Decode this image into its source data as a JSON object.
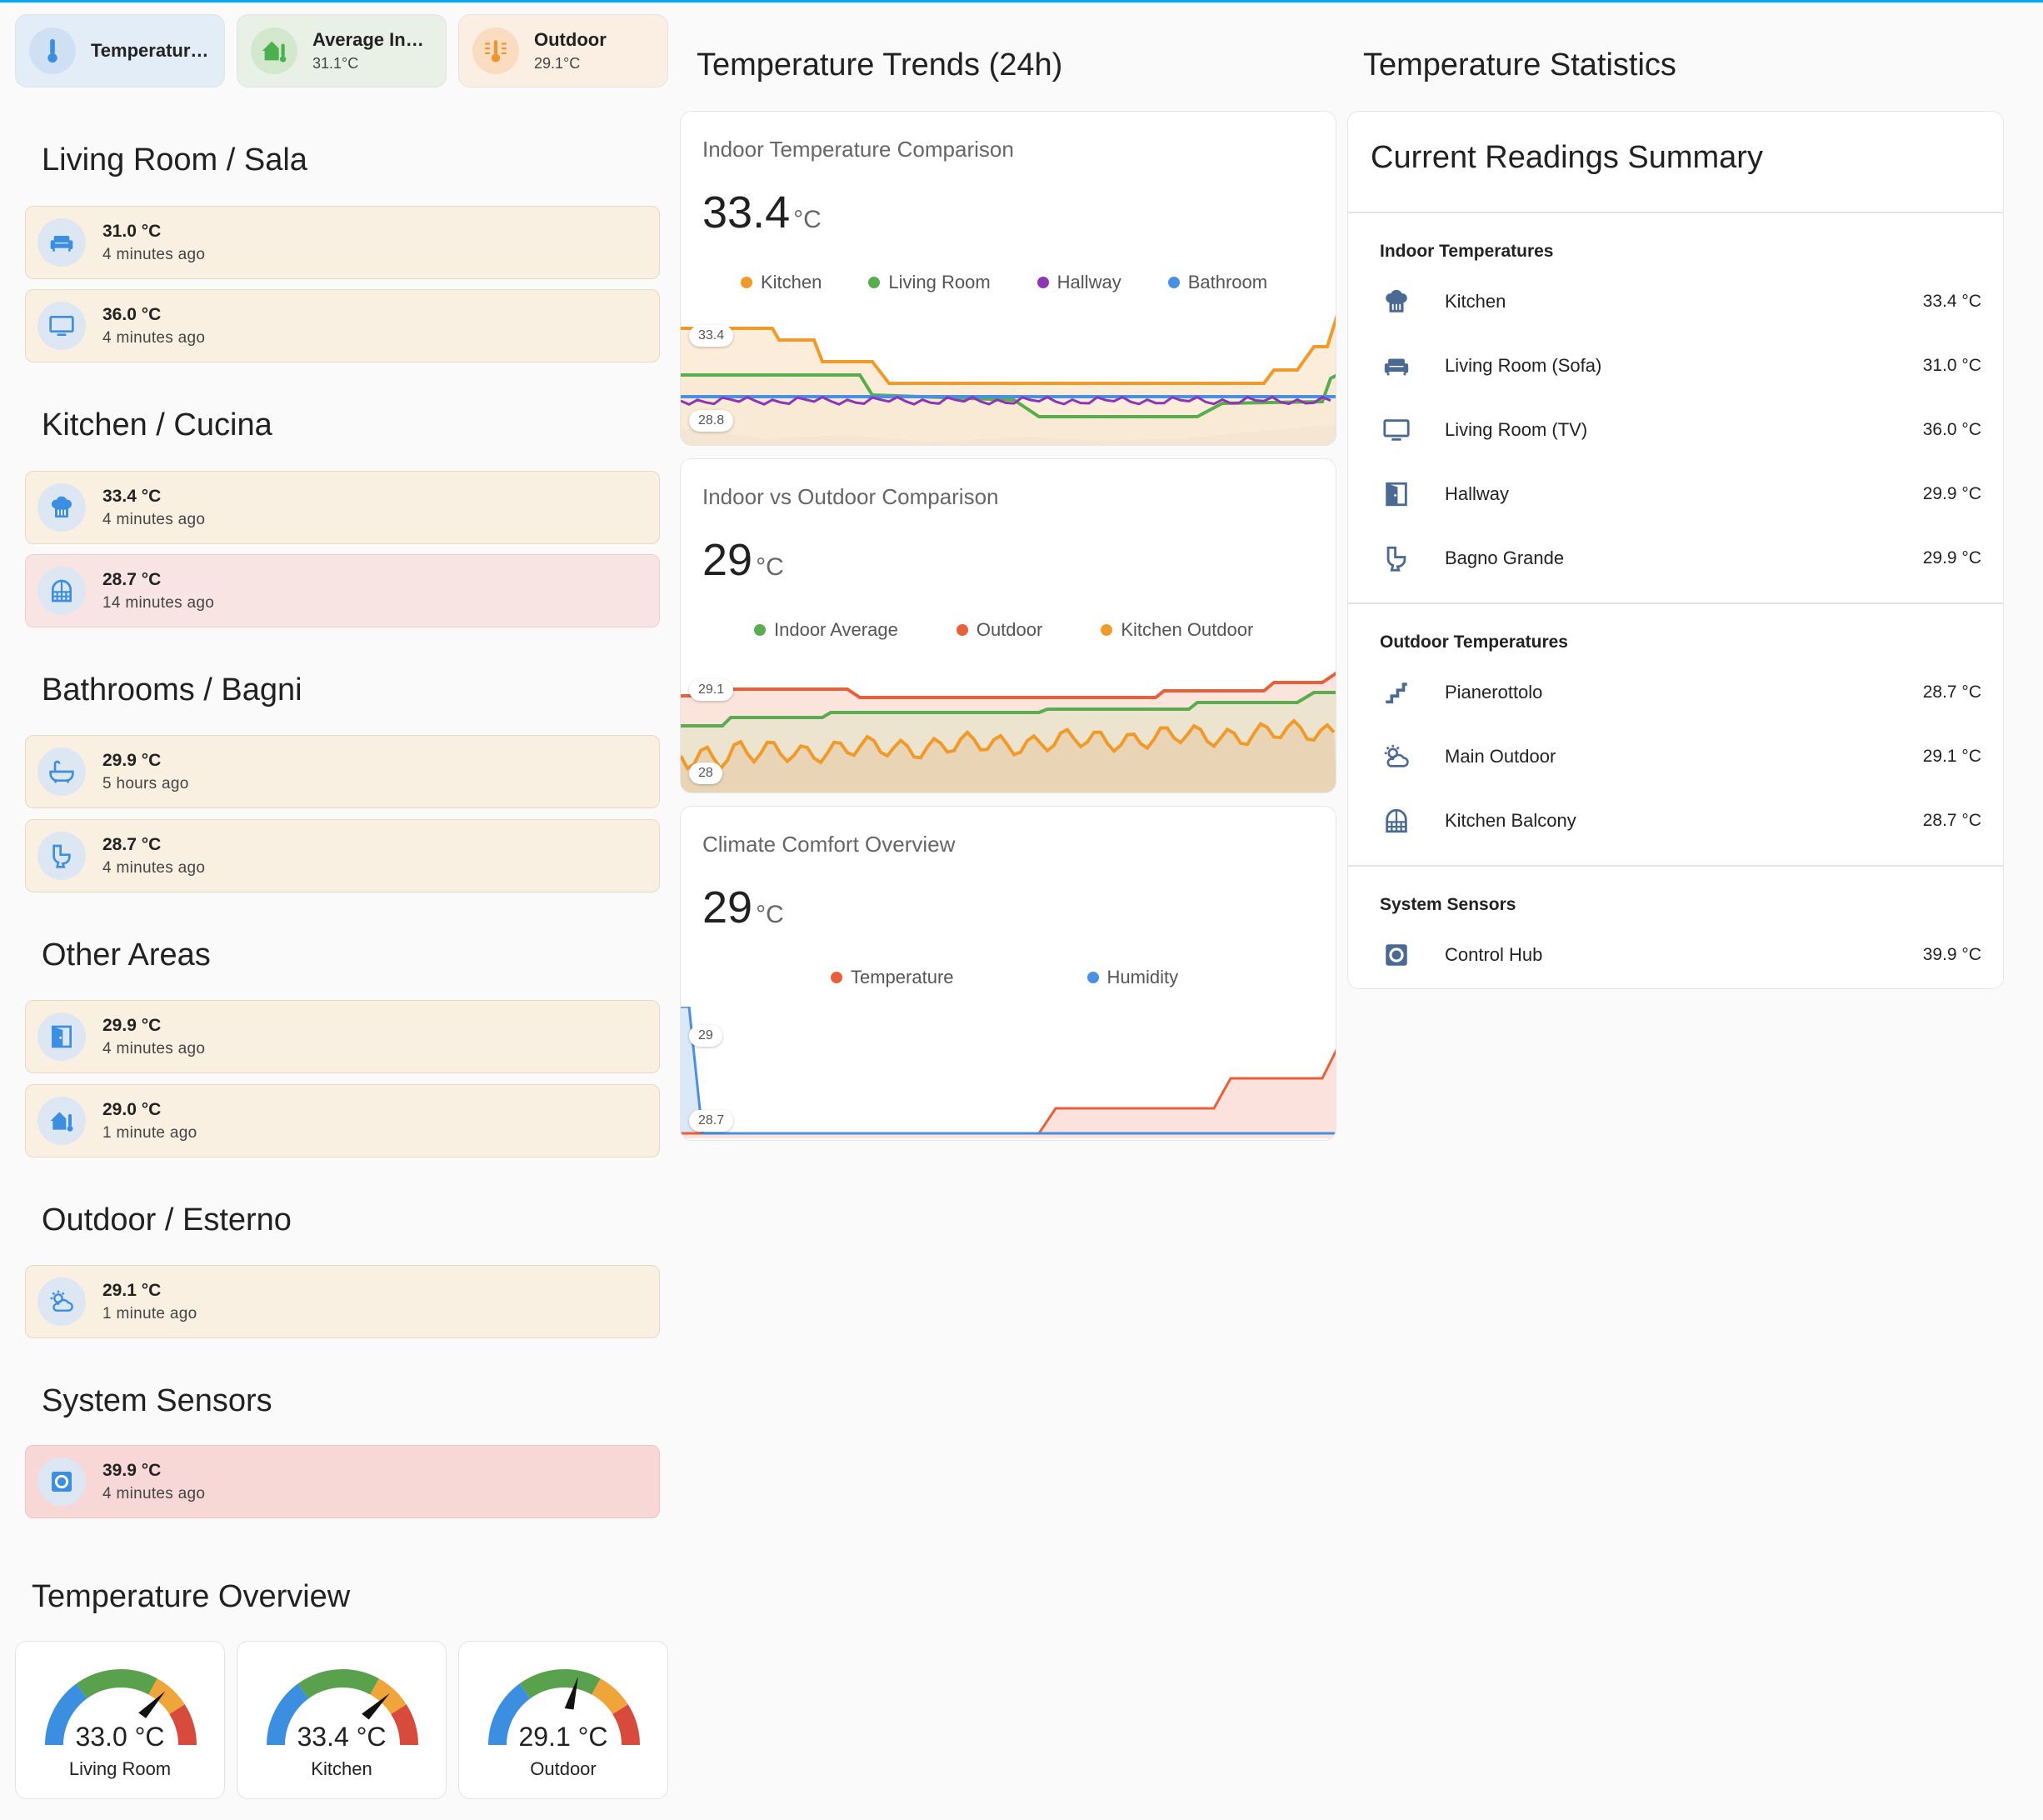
{
  "chips": [
    {
      "label": "Temperature...",
      "value": "",
      "icon": "thermometer-icon",
      "bg": "#e3edf8",
      "icon_bg": "#cfe0f4",
      "icon_color": "#3b8ee0"
    },
    {
      "label": "Average Indo...",
      "value": "31.1°C",
      "icon": "home-thermometer-icon",
      "bg": "#e9f1e6",
      "icon_bg": "#d3e7cd",
      "icon_color": "#4caf50"
    },
    {
      "label": "Outdoor",
      "value": "29.1°C",
      "icon": "sun-thermometer-icon",
      "bg": "#fbeee2",
      "icon_bg": "#fadcc0",
      "icon_color": "#f0942e"
    }
  ],
  "sections": [
    {
      "title": "Living Room / Sala",
      "tiles": [
        {
          "value": "31.0 °C",
          "ago": "4 minutes ago",
          "icon": "sofa-icon",
          "tone": "warm"
        },
        {
          "value": "36.0 °C",
          "ago": "4 minutes ago",
          "icon": "tv-icon",
          "tone": "warm"
        }
      ]
    },
    {
      "title": "Kitchen / Cucina",
      "tiles": [
        {
          "value": "33.4 °C",
          "ago": "4 minutes ago",
          "icon": "chef-hat-icon",
          "tone": "warm"
        },
        {
          "value": "28.7 °C",
          "ago": "14 minutes ago",
          "icon": "window-icon",
          "tone": "hot"
        }
      ]
    },
    {
      "title": "Bathrooms / Bagni",
      "tiles": [
        {
          "value": "29.9 °C",
          "ago": "5 hours ago",
          "icon": "bathtub-icon",
          "tone": "warm"
        },
        {
          "value": "28.7 °C",
          "ago": "4 minutes ago",
          "icon": "toilet-icon",
          "tone": "warm"
        }
      ]
    },
    {
      "title": "Other Areas",
      "tiles": [
        {
          "value": "29.9 °C",
          "ago": "4 minutes ago",
          "icon": "door-icon",
          "tone": "warm"
        },
        {
          "value": "29.0 °C",
          "ago": "1 minute ago",
          "icon": "home-thermometer-icon",
          "tone": "warm"
        }
      ]
    },
    {
      "title": "Outdoor / Esterno",
      "tiles": [
        {
          "value": "29.1 °C",
          "ago": "1 minute ago",
          "icon": "weather-partly-cloudy-icon",
          "tone": "warm"
        }
      ]
    },
    {
      "title": "System Sensors",
      "tiles": [
        {
          "value": "39.9 °C",
          "ago": "4 minutes ago",
          "icon": "hub-icon",
          "tone": "hotter"
        }
      ]
    }
  ],
  "overview": {
    "title": "Temperature Overview",
    "gauges": [
      {
        "value": "33.0 °C",
        "label": "Living Room",
        "num": 33.0
      },
      {
        "value": "33.4 °C",
        "label": "Kitchen",
        "num": 33.4
      },
      {
        "value": "29.1 °C",
        "label": "Outdoor",
        "num": 29.1
      }
    ]
  },
  "trends": {
    "title": "Temperature Trends (24h)",
    "cards": [
      {
        "title": "Indoor Temperature Comparison",
        "big": "33.4",
        "unit": "°C",
        "legend": [
          {
            "name": "Kitchen",
            "color": "#f09a2a"
          },
          {
            "name": "Living Room",
            "color": "#5aad4f"
          },
          {
            "name": "Hallway",
            "color": "#8e35b5"
          },
          {
            "name": "Bathroom",
            "color": "#4a90e2"
          }
        ],
        "badge_top": "33.4",
        "badge_bottom": "28.8"
      },
      {
        "title": "Indoor vs Outdoor Comparison",
        "big": "29",
        "unit": "°C",
        "legend": [
          {
            "name": "Indoor Average",
            "color": "#5aad4f"
          },
          {
            "name": "Outdoor",
            "color": "#e8603a"
          },
          {
            "name": "Kitchen Outdoor",
            "color": "#f09a2a"
          }
        ],
        "badge_top": "29.1",
        "badge_bottom": "28"
      },
      {
        "title": "Climate Comfort Overview",
        "big": "29",
        "unit": "°C",
        "legend": [
          {
            "name": "Temperature",
            "color": "#e8603a"
          },
          {
            "name": "Humidity",
            "color": "#4a90e2"
          }
        ],
        "badge_top": "29",
        "badge_bottom": "28.7"
      }
    ]
  },
  "stats": {
    "title": "Temperature Statistics",
    "card_title": "Current Readings Summary",
    "groups": [
      {
        "name": "Indoor Temperatures",
        "rows": [
          {
            "name": "Kitchen",
            "value": "33.4 °C",
            "icon": "chef-hat-icon"
          },
          {
            "name": "Living Room (Sofa)",
            "value": "31.0 °C",
            "icon": "sofa-icon"
          },
          {
            "name": "Living Room (TV)",
            "value": "36.0 °C",
            "icon": "tv-icon"
          },
          {
            "name": "Hallway",
            "value": "29.9 °C",
            "icon": "door-icon"
          },
          {
            "name": "Bagno Grande",
            "value": "29.9 °C",
            "icon": "toilet-icon"
          }
        ]
      },
      {
        "name": "Outdoor Temperatures",
        "rows": [
          {
            "name": "Pianerottolo",
            "value": "28.7 °C",
            "icon": "stairs-icon"
          },
          {
            "name": "Main Outdoor",
            "value": "29.1 °C",
            "icon": "weather-partly-cloudy-icon"
          },
          {
            "name": "Kitchen Balcony",
            "value": "28.7 °C",
            "icon": "window-icon"
          }
        ]
      },
      {
        "name": "System Sensors",
        "rows": [
          {
            "name": "Control Hub",
            "value": "39.9 °C",
            "icon": "hub-icon"
          }
        ]
      }
    ]
  }
}
